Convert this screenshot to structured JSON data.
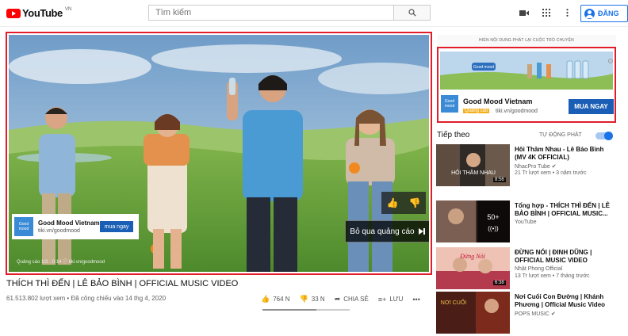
{
  "header": {
    "logo_text": "YouTube",
    "logo_region": "VN",
    "search_placeholder": "Tìm kiếm",
    "signin_label": "ĐĂNG",
    "icons": [
      "video-camera-icon",
      "apps-grid-icon",
      "more-vert-icon",
      "account-circle-icon"
    ]
  },
  "player": {
    "overlay_ad": {
      "logo_text": "Good mood",
      "title": "Good Mood Vietnam",
      "url": "tiki.vn/goodmood",
      "button": "mua ngay"
    },
    "skip_label": "Bỏ qua quảng cáo",
    "ad_info": "Quảng cáo 1/2 · 0:14 ⓘ  tiki.vn/goodmood"
  },
  "video": {
    "title": "THÍCH THÌ ĐẾN | LÊ BẢO BÌNH | OFFICIAL MUSIC VIDEO",
    "meta": "61.513.802 lượt xem • Đã công chiếu vào 14 thg 4, 2020",
    "likes": "764 N",
    "dislikes": "33 N",
    "share": "CHIA SẺ",
    "save": "LƯU",
    "like_ratio": 0.62
  },
  "sidebar_ad": {
    "label": "HIỂN NỘI DUNG PHÁT LẠI CUỘC TRÒ CHUYỆN",
    "logo_text": "Good mood",
    "title": "Good Mood Vietnam",
    "badge": "Quảng cáo",
    "url": "tiki.vn/goodmood",
    "cta": "MUA NGAY"
  },
  "upnext": {
    "title": "Tiếp theo",
    "autoplay_label": "TỰ ĐỘNG PHÁT",
    "autoplay_on": true
  },
  "recommendations": [
    {
      "title": "Hôi Thăm Nhau - Lê Bảo Bình (MV 4K OFFICIAL)",
      "channel": "NhacPro Tube ✔",
      "views": "21 Tr lượt xem • 3 năm trước",
      "duration": "8:56",
      "thumb_text": "HỎI THĂM NHAU"
    },
    {
      "title": "Tổng hợp - THÍCH THÌ ĐẾN | LÊ BẢO BÌNH | OFFICIAL MUSIC...",
      "channel": "YouTube",
      "views": "",
      "duration": "",
      "thumb_text": "50+"
    },
    {
      "title": "ĐỪNG NÓI | ĐINH DŨNG | OFFICIAL MUSIC VIDEO",
      "channel": "Nhật Phong Official",
      "views": "13 Tr lượt xem • 7 tháng trước",
      "duration": "6:38",
      "thumb_text": "Đừng Nói"
    },
    {
      "title": "Nơi Cuối Con Đường | Khánh Phương | Official Music Video",
      "channel": "POPS MUSIC ✔",
      "views": "",
      "duration": "",
      "thumb_text": "NƠI CUỐI"
    }
  ]
}
